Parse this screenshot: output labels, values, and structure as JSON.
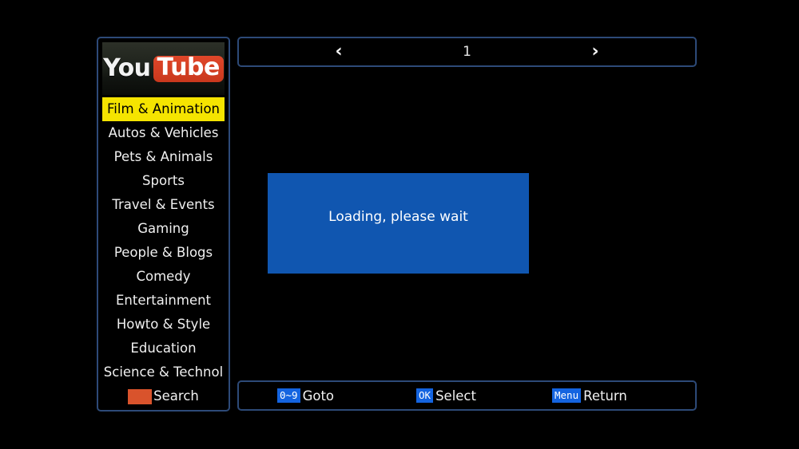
{
  "app": {
    "background_color": "#000000",
    "panel_border_color": "#2d4a78"
  },
  "sidebar": {
    "logo": {
      "name": "youtube-logo",
      "text_primary": "You",
      "text_secondary": "Tube",
      "badge_color": "#cf3a20"
    },
    "selected_index": 0,
    "highlight_color": "#f5e400",
    "items": [
      {
        "label": "Film & Animation",
        "selected": true
      },
      {
        "label": "Autos & Vehicles",
        "selected": false
      },
      {
        "label": "Pets & Animals",
        "selected": false
      },
      {
        "label": "Sports",
        "selected": false
      },
      {
        "label": "Travel & Events",
        "selected": false
      },
      {
        "label": "Gaming",
        "selected": false
      },
      {
        "label": "People & Blogs",
        "selected": false
      },
      {
        "label": "Comedy",
        "selected": false
      },
      {
        "label": "Entertainment",
        "selected": false
      },
      {
        "label": "Howto & Style",
        "selected": false
      },
      {
        "label": "Education",
        "selected": false
      },
      {
        "label": "Science & Technol",
        "selected": false
      }
    ],
    "search": {
      "label": "Search",
      "icon": "search-swatch",
      "swatch_color": "#d9532c"
    }
  },
  "topbar": {
    "prev_icon": "chevron-left-icon",
    "prev_glyph": "‹",
    "page_number": "1",
    "next_icon": "chevron-right-icon",
    "next_glyph": "›"
  },
  "main": {
    "loading_panel": {
      "message": "Loading, please wait",
      "background_color": "#1056b0",
      "text_color": "#ffffff"
    }
  },
  "bottombar": {
    "badge_color": "#1464e0",
    "hints": [
      {
        "key": "0~9",
        "label": "Goto"
      },
      {
        "key": "OK",
        "label": "Select"
      },
      {
        "key": "Menu",
        "label": "Return"
      }
    ]
  }
}
